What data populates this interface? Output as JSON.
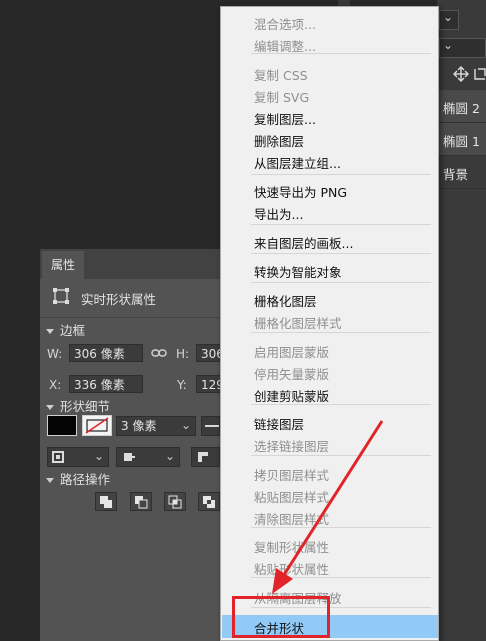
{
  "topbar": {
    "dropdown_arrow": "⌄"
  },
  "properties_panel": {
    "tab_label": "属性",
    "shape_title": "实时形状属性",
    "bounds": {
      "section": "边框",
      "w_label": "W:",
      "w_value": "306 像素",
      "h_label": "H:",
      "h_value": "306",
      "x_label": "X:",
      "x_value": "336 像素",
      "y_label": "Y:",
      "y_value": "129"
    },
    "shape_details": {
      "section": "形状细节",
      "stroke_size": "3 像素"
    },
    "path_ops": {
      "section": "路径操作"
    }
  },
  "layers_panel": {
    "layers": [
      {
        "name": "椭圆 2",
        "selected": true
      },
      {
        "name": "椭圆 1",
        "selected": true
      },
      {
        "name": "背景",
        "selected": false
      }
    ]
  },
  "context_menu": {
    "items": [
      {
        "label": "混合选项...",
        "disabled": true
      },
      {
        "label": "编辑调整...",
        "disabled": true
      },
      {
        "label": "复制 CSS",
        "disabled": true
      },
      {
        "label": "复制 SVG",
        "disabled": true
      },
      {
        "label": "复制图层...",
        "disabled": false
      },
      {
        "label": "删除图层",
        "disabled": false
      },
      {
        "label": "从图层建立组...",
        "disabled": false
      },
      {
        "label": "快速导出为 PNG",
        "disabled": false
      },
      {
        "label": "导出为...",
        "disabled": false
      },
      {
        "label": "来自图层的画板...",
        "disabled": false
      },
      {
        "label": "转换为智能对象",
        "disabled": false
      },
      {
        "label": "栅格化图层",
        "disabled": false
      },
      {
        "label": "栅格化图层样式",
        "disabled": true
      },
      {
        "label": "启用图层蒙版",
        "disabled": true
      },
      {
        "label": "停用矢量蒙版",
        "disabled": true
      },
      {
        "label": "创建剪贴蒙版",
        "disabled": false
      },
      {
        "label": "链接图层",
        "disabled": false
      },
      {
        "label": "选择链接图层",
        "disabled": true
      },
      {
        "label": "拷贝图层样式",
        "disabled": true
      },
      {
        "label": "粘贴图层样式",
        "disabled": true
      },
      {
        "label": "清除图层样式",
        "disabled": true
      },
      {
        "label": "复制形状属性",
        "disabled": true
      },
      {
        "label": "粘贴形状属性",
        "disabled": true
      },
      {
        "label": "从隔离图层释放",
        "disabled": true
      },
      {
        "label": "合并形状",
        "disabled": false,
        "highlighted": true
      }
    ]
  },
  "colors": {
    "menu_highlight": "#91c9f7",
    "annotation_red": "#e0242a",
    "panel_bg": "#535353"
  }
}
